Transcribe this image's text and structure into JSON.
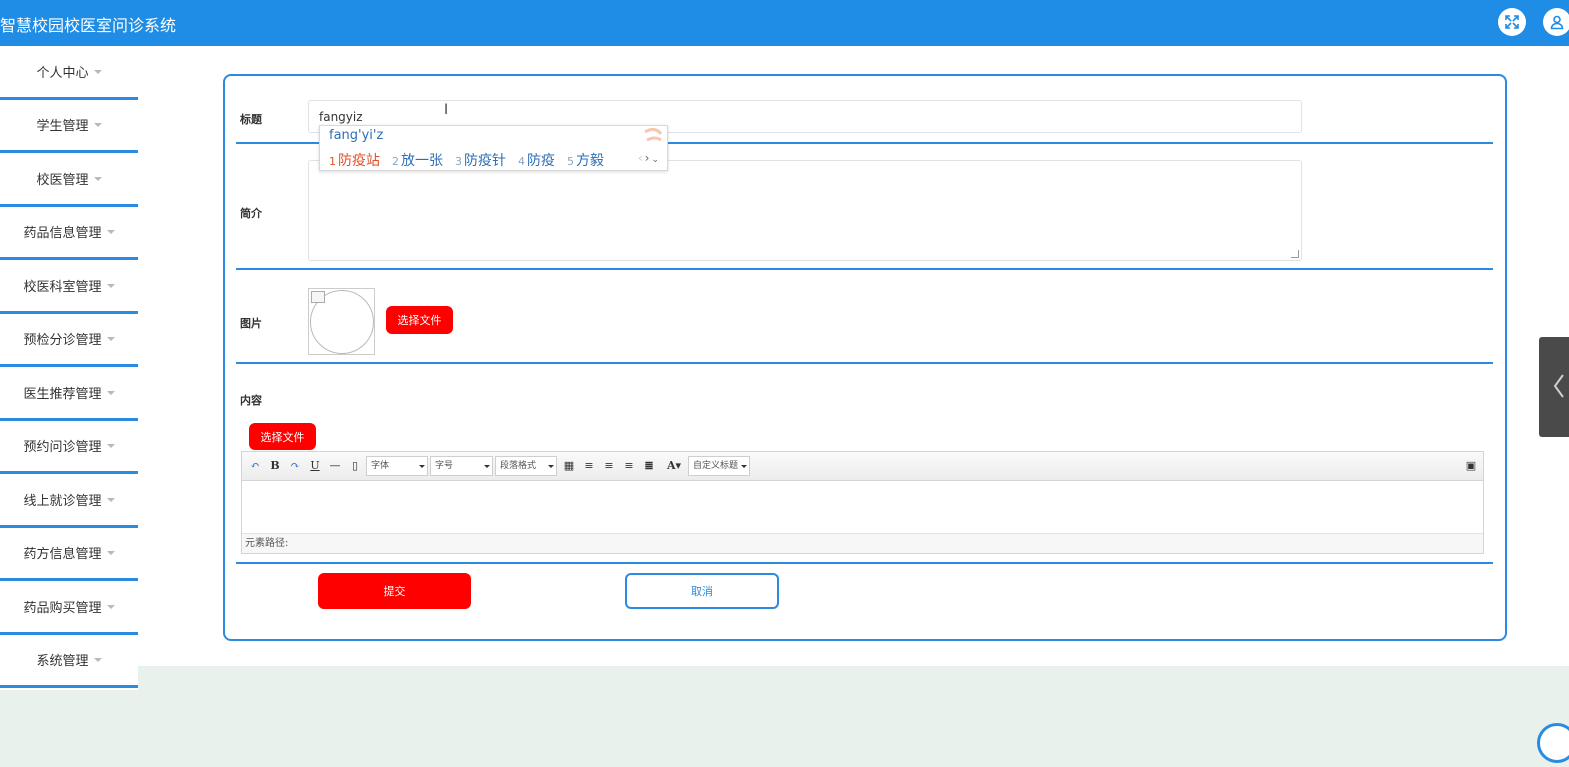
{
  "header": {
    "title": "智慧校园校医室问诊系统",
    "icons": [
      "fullscreen-icon",
      "user-icon"
    ]
  },
  "sidebar": {
    "items": [
      {
        "label": "个人中心"
      },
      {
        "label": "学生管理"
      },
      {
        "label": "校医管理"
      },
      {
        "label": "药品信息管理"
      },
      {
        "label": "校医科室管理"
      },
      {
        "label": "预检分诊管理"
      },
      {
        "label": "医生推荐管理"
      },
      {
        "label": "预约问诊管理"
      },
      {
        "label": "线上就诊管理"
      },
      {
        "label": "药方信息管理"
      },
      {
        "label": "药品购买管理"
      },
      {
        "label": "系统管理"
      }
    ]
  },
  "form": {
    "title_label": "标题",
    "title_value": "fangyiz",
    "summary_label": "简介",
    "summary_value": "",
    "image_label": "图片",
    "image_upload_button": "选择文件",
    "content_label": "内容",
    "content_upload_button": "选择文件",
    "submit_button": "提交",
    "cancel_button": "取消"
  },
  "ime": {
    "pinyin": "fang'yi'z",
    "candidates": [
      {
        "num": "1",
        "text": "防疫站"
      },
      {
        "num": "2",
        "text": "放一张"
      },
      {
        "num": "3",
        "text": "防疫针"
      },
      {
        "num": "4",
        "text": "防疫"
      },
      {
        "num": "5",
        "text": "方毅"
      }
    ]
  },
  "editor": {
    "font_select": "字体",
    "size_select": "字号",
    "paragraph_select": "段落格式",
    "custom_title_select": "自定义标题",
    "status_path": "元素路径:"
  },
  "colors": {
    "primary": "#1f8ce6",
    "border_blue": "#2a8be0",
    "danger": "#ff0000"
  }
}
